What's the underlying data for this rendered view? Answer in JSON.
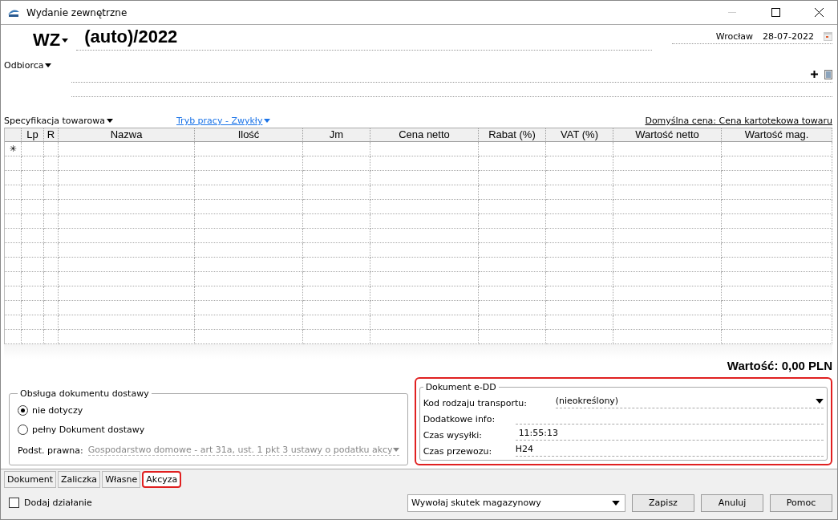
{
  "window": {
    "title": "Wydanie zewnętrzne"
  },
  "header": {
    "doc_type": "WZ",
    "number": "(auto)/2022",
    "place": "Wrocław",
    "date": "28-07-2022"
  },
  "recipient": {
    "label": "Odbiorca"
  },
  "toolbar": {
    "spec": "Specyfikacja towarowa",
    "mode": "Tryb pracy - Zwykły",
    "price": "Domyślna cena: Cena kartotekowa towaru"
  },
  "table": {
    "columns": [
      "",
      "Lp",
      "R",
      "Nazwa",
      "Ilość",
      "Jm",
      "Cena netto",
      "Rabat (%)",
      "VAT (%)",
      "Wartość netto",
      "Wartość mag."
    ],
    "new_row_marker": "✳"
  },
  "total": "Wartość: 0,00 PLN",
  "delivery": {
    "title": "Obsługa dokumentu dostawy",
    "options": [
      {
        "label": "nie dotyczy",
        "selected": true
      },
      {
        "label": "pełny Dokument dostawy",
        "selected": false
      }
    ],
    "basis_label": "Podst. prawna:",
    "basis_value": "Gospodarstwo domowe - art 31a, ust. 1 pkt 3 ustawy o podatku akcy"
  },
  "edd": {
    "title": "Dokument e-DD",
    "highlighted": true,
    "fields": [
      {
        "label": "Kod rodzaju transportu:",
        "value": "(nieokreślony)",
        "kind": "dropdown"
      },
      {
        "label": "Dodatkowe info:",
        "kind": "text"
      },
      {
        "label": "Czas wysyłki:",
        "value": "11:55:13",
        "kind": "text"
      },
      {
        "label": "Czas przewozu:",
        "value": "H24",
        "kind": "text"
      }
    ]
  },
  "tabs": [
    {
      "label": "Dokument",
      "selected": false,
      "highlighted": false
    },
    {
      "label": "Zaliczka",
      "selected": false,
      "highlighted": false
    },
    {
      "label": "Własne",
      "selected": false,
      "highlighted": false
    },
    {
      "label": "Akcyza",
      "selected": true,
      "highlighted": true
    }
  ],
  "footer": {
    "add_action": {
      "label": "Dodaj działanie",
      "checked": false
    },
    "effect": "Wywołaj skutek magazynowy",
    "buttons": [
      "Zapisz",
      "Anuluj",
      "Pomoc"
    ]
  }
}
